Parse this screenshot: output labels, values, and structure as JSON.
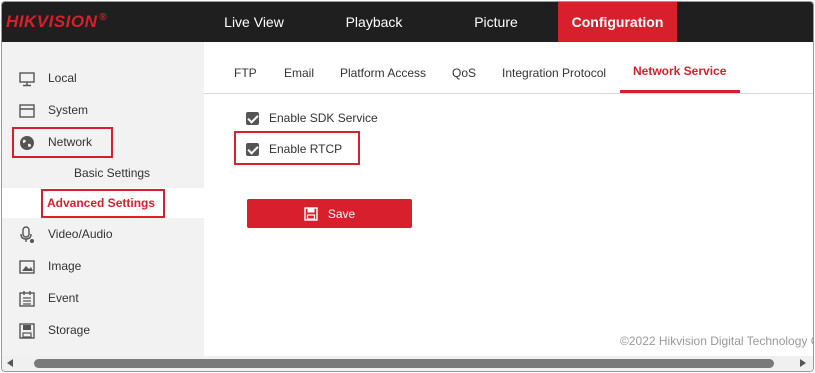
{
  "brand": {
    "name": "HIKVISION",
    "reg": "®",
    "color": "#d7202b"
  },
  "topnav": {
    "items": [
      {
        "label": "Live View",
        "active": false
      },
      {
        "label": "Playback",
        "active": false
      },
      {
        "label": "Picture",
        "active": false
      },
      {
        "label": "Configuration",
        "active": true
      }
    ]
  },
  "sidebar": {
    "items": [
      {
        "label": "Local",
        "icon": "monitor-icon"
      },
      {
        "label": "System",
        "icon": "system-window-icon"
      },
      {
        "label": "Network",
        "icon": "globe-icon",
        "highlighted": true
      },
      {
        "label": "Video/Audio",
        "icon": "microphone-icon"
      },
      {
        "label": "Image",
        "icon": "image-icon"
      },
      {
        "label": "Event",
        "icon": "calendar-icon"
      },
      {
        "label": "Storage",
        "icon": "storage-disk-icon"
      }
    ],
    "network_sub": [
      {
        "label": "Basic Settings",
        "active": false
      },
      {
        "label": "Advanced Settings",
        "active": true,
        "highlighted": true
      }
    ]
  },
  "tabs": [
    {
      "label": "FTP",
      "active": false
    },
    {
      "label": "Email",
      "active": false
    },
    {
      "label": "Platform Access",
      "active": false
    },
    {
      "label": "QoS",
      "active": false
    },
    {
      "label": "Integration Protocol",
      "active": false
    },
    {
      "label": "Network Service",
      "active": true
    }
  ],
  "form": {
    "options": [
      {
        "label": "Enable SDK Service",
        "checked": true
      },
      {
        "label": "Enable RTCP",
        "checked": true,
        "highlighted": true
      }
    ],
    "save_label": "Save"
  },
  "footer": {
    "copyright": "©2022 Hikvision Digital Technology C"
  },
  "colors": {
    "accent": "#d7202b",
    "topbar": "#1f1f1f",
    "sidebar": "#f2f2f2"
  }
}
